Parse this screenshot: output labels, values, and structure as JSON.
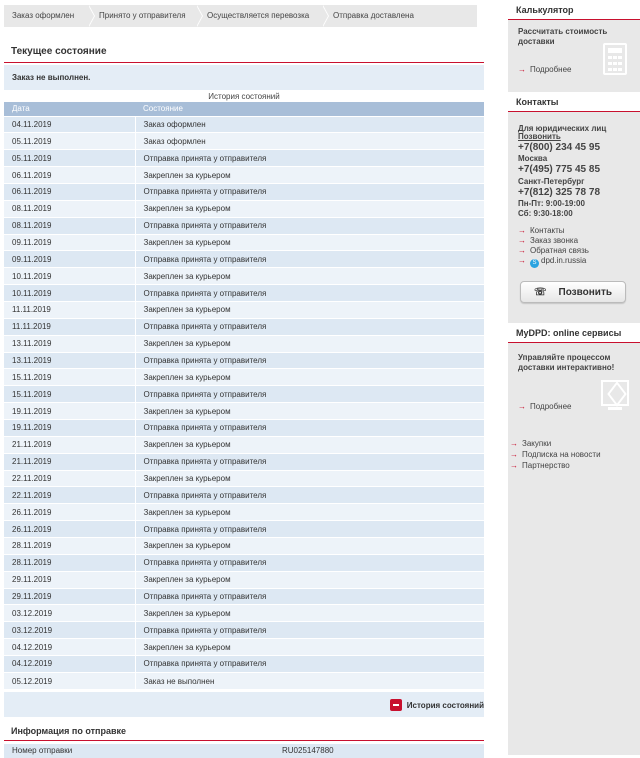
{
  "steps": [
    "Заказ оформлен",
    "Принято у отправителя",
    "Осуществляется перевозка",
    "Отправка доставлена"
  ],
  "current": {
    "heading": "Текущее состояние",
    "status": "Заказ не выполнен."
  },
  "history": {
    "caption": "История состояний",
    "columns": [
      "Дата",
      "Состояние"
    ],
    "rows": [
      [
        "04.11.2019",
        "Заказ оформлен"
      ],
      [
        "05.11.2019",
        "Заказ оформлен"
      ],
      [
        "05.11.2019",
        "Отправка принята у отправителя"
      ],
      [
        "06.11.2019",
        "Закреплен за курьером"
      ],
      [
        "06.11.2019",
        "Отправка принята у отправителя"
      ],
      [
        "08.11.2019",
        "Закреплен за курьером"
      ],
      [
        "08.11.2019",
        "Отправка принята у отправителя"
      ],
      [
        "09.11.2019",
        "Закреплен за курьером"
      ],
      [
        "09.11.2019",
        "Отправка принята у отправителя"
      ],
      [
        "10.11.2019",
        "Закреплен за курьером"
      ],
      [
        "10.11.2019",
        "Отправка принята у отправителя"
      ],
      [
        "11.11.2019",
        "Закреплен за курьером"
      ],
      [
        "11.11.2019",
        "Отправка принята у отправителя"
      ],
      [
        "13.11.2019",
        "Закреплен за курьером"
      ],
      [
        "13.11.2019",
        "Отправка принята у отправителя"
      ],
      [
        "15.11.2019",
        "Закреплен за курьером"
      ],
      [
        "15.11.2019",
        "Отправка принята у отправителя"
      ],
      [
        "19.11.2019",
        "Закреплен за курьером"
      ],
      [
        "19.11.2019",
        "Отправка принята у отправителя"
      ],
      [
        "21.11.2019",
        "Закреплен за курьером"
      ],
      [
        "21.11.2019",
        "Отправка принята у отправителя"
      ],
      [
        "22.11.2019",
        "Закреплен за курьером"
      ],
      [
        "22.11.2019",
        "Отправка принята у отправителя"
      ],
      [
        "26.11.2019",
        "Закреплен за курьером"
      ],
      [
        "26.11.2019",
        "Отправка принята у отправителя"
      ],
      [
        "28.11.2019",
        "Закреплен за курьером"
      ],
      [
        "28.11.2019",
        "Отправка принята у отправителя"
      ],
      [
        "29.11.2019",
        "Закреплен за курьером"
      ],
      [
        "29.11.2019",
        "Отправка принята у отправителя"
      ],
      [
        "03.12.2019",
        "Закреплен за курьером"
      ],
      [
        "03.12.2019",
        "Отправка принята у отправителя"
      ],
      [
        "04.12.2019",
        "Закреплен за курьером"
      ],
      [
        "04.12.2019",
        "Отправка принята у отправителя"
      ],
      [
        "05.12.2019",
        "Заказ не выполнен"
      ]
    ],
    "toggle_label": "История состояний"
  },
  "shipment": {
    "heading": "Информация по отправке",
    "number_label": "Номер отправки",
    "number_value": "RU025147880"
  },
  "sidebar": {
    "calculator": {
      "title": "Калькулятор",
      "text": "Рассчитать стоимость доставки",
      "more": "Подробнее"
    },
    "contacts": {
      "title": "Контакты",
      "legal": "Для юридических лиц",
      "call_link": "Позвонить",
      "phone_main": "+7(800) 234 45 95",
      "city1": "Москва",
      "phone_city1": "+7(495) 775 45 85",
      "city2": "Санкт-Петербург",
      "phone_city2": "+7(812) 325 78 78",
      "hours1": "Пн-Пт: 9:00-19:00",
      "hours2": "Сб: 9:30-18:00",
      "links": [
        "Контакты",
        "Заказ звонка",
        "Обратная связь",
        "dpd.in.russia"
      ],
      "call_button": "Позвонить"
    },
    "mydpd": {
      "title": "MyDPD: online сервисы",
      "text": "Управляйте процессом доставки интерактивно!",
      "more": "Подробнее"
    },
    "footer_links": [
      "Закупки",
      "Подписка на новости",
      "Партнерство"
    ]
  },
  "colors": {
    "accent": "#c8102e",
    "table_header": "#a8bed8",
    "row_light": "#edf3f9",
    "row_dark": "#dde8f3",
    "sidebar_bg": "#e8e8e8"
  }
}
